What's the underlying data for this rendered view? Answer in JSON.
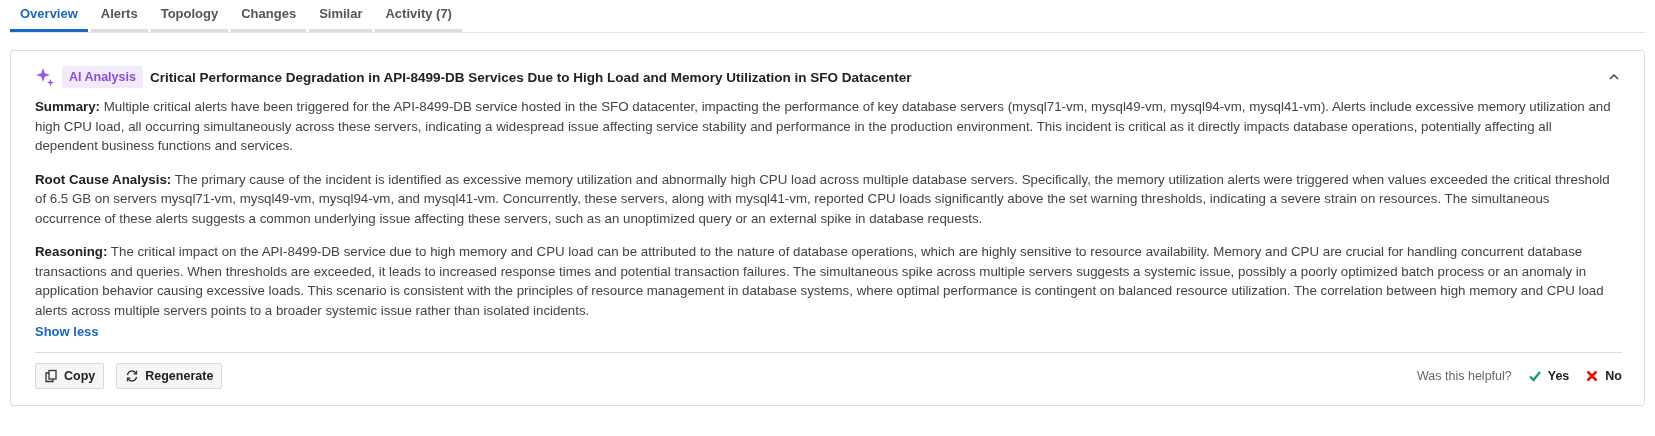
{
  "tabs": [
    {
      "label": "Overview",
      "selected": true
    },
    {
      "label": "Alerts",
      "selected": false
    },
    {
      "label": "Topology",
      "selected": false
    },
    {
      "label": "Changes",
      "selected": false
    },
    {
      "label": "Similar",
      "selected": false
    },
    {
      "label": "Activity (7)",
      "selected": false
    }
  ],
  "analysis": {
    "badge": "AI Analysis",
    "title": "Critical Performance Degradation in API-8499-DB Services Due to High Load and Memory Utilization in SFO Datacenter",
    "expanded": true,
    "sections": [
      {
        "label": "Summary:",
        "text": "Multiple critical alerts have been triggered for the API-8499-DB service hosted in the SFO datacenter, impacting the performance of key database servers (mysql71-vm, mysql49-vm, mysql94-vm, mysql41-vm). Alerts include excessive memory utilization and high CPU load, all occurring simultaneously across these servers, indicating a widespread issue affecting service stability and performance in the production environment. This incident is critical as it directly impacts database operations, potentially affecting all dependent business functions and services."
      },
      {
        "label": "Root Cause Analysis:",
        "text": "The primary cause of the incident is identified as excessive memory utilization and abnormally high CPU load across multiple database servers. Specifically, the memory utilization alerts were triggered when values exceeded the critical threshold of 6.5 GB on servers mysql71-vm, mysql49-vm, mysql94-vm, and mysql41-vm. Concurrently, these servers, along with mysql41-vm, reported CPU loads significantly above the set warning thresholds, indicating a severe strain on resources. The simultaneous occurrence of these alerts suggests a common underlying issue affecting these servers, such as an unoptimized query or an external spike in database requests."
      },
      {
        "label": "Reasoning:",
        "text": "The critical impact on the API-8499-DB service due to high memory and CPU load can be attributed to the nature of database operations, which are highly sensitive to resource availability. Memory and CPU are crucial for handling concurrent database transactions and queries. When thresholds are exceeded, it leads to increased response times and potential transaction failures. The simultaneous spike across multiple servers suggests a systemic issue, possibly a poorly optimized batch process or an anomaly in application behavior causing excessive loads. This scenario is consistent with the principles of resource management in database systems, where optimal performance is contingent on balanced resource utilization. The correlation between high memory and CPU load alerts across multiple servers points to a broader systemic issue rather than isolated incidents."
      }
    ],
    "toggle_link": "Show less",
    "actions": [
      {
        "kind": "copy",
        "label": "Copy"
      },
      {
        "kind": "regenerate",
        "label": "Regenerate"
      }
    ],
    "feedback": {
      "question": "Was this helpful?",
      "yes": "Yes",
      "no": "No"
    }
  }
}
